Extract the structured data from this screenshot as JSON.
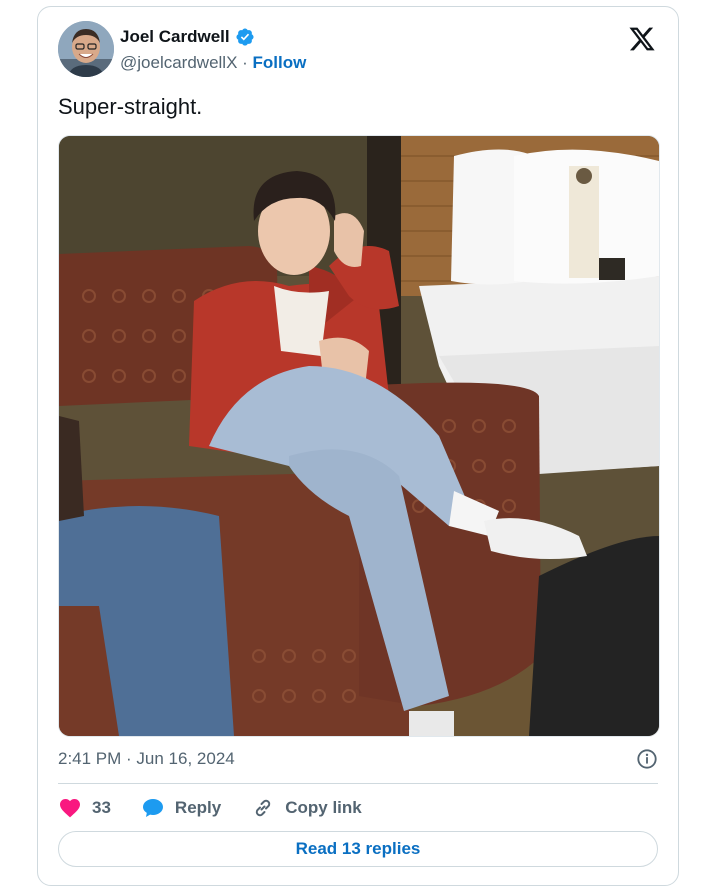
{
  "author": {
    "display_name": "Joel Cardwell",
    "handle": "@joelcardwellX",
    "separator": " · ",
    "follow_label": "Follow",
    "verified_icon": "verified-badge-icon",
    "avatar_icon": "avatar"
  },
  "platform_logo": "x-logo-icon",
  "tweet": {
    "text": "Super-straight.",
    "timestamp": "2:41 PM · Jun 16, 2024",
    "media": "photo"
  },
  "actions": {
    "like_count": "33",
    "reply_label": "Reply",
    "copy_link_label": "Copy link"
  },
  "read_replies_label": "Read 13 replies",
  "colors": {
    "link_blue": "#0a6fc2",
    "verified_blue": "#1d9bf0",
    "like_pink": "#f91880",
    "text_secondary": "#536471",
    "border": "#cfd9de"
  }
}
